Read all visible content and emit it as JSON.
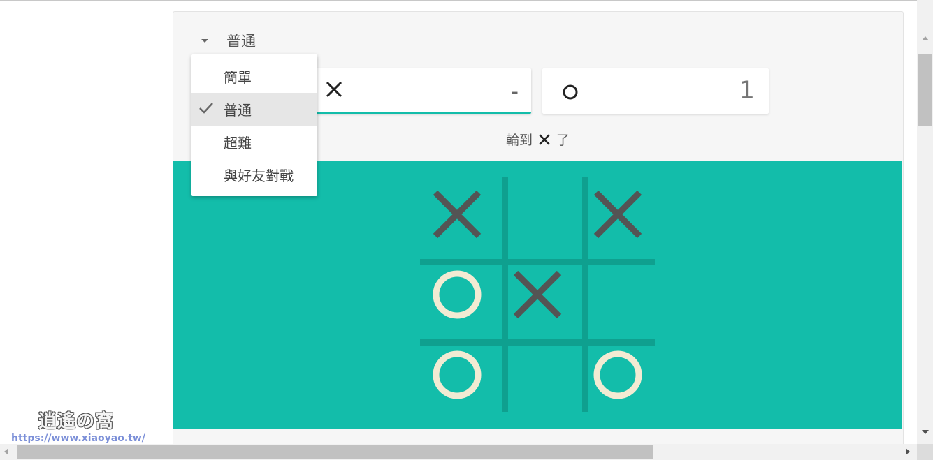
{
  "level_select": {
    "current": "普通",
    "icon": "caret-down-icon"
  },
  "dropdown": {
    "items": [
      {
        "label": "簡單",
        "selected": false
      },
      {
        "label": "普通",
        "selected": true
      },
      {
        "label": "超難",
        "selected": false
      },
      {
        "label": "與好友對戰",
        "selected": false
      }
    ],
    "check_icon": "check-icon"
  },
  "score": {
    "x": {
      "mark": "X",
      "value": "-",
      "active": true
    },
    "o": {
      "mark": "O",
      "value": "1",
      "active": false
    }
  },
  "turn": {
    "prefix": "輪到",
    "mark": "X",
    "suffix": "了"
  },
  "board": {
    "cells": [
      [
        "X",
        "",
        "X"
      ],
      [
        "O",
        "X",
        ""
      ],
      [
        "O",
        "",
        "O"
      ]
    ]
  },
  "colors": {
    "board_bg": "#13bdaa",
    "grid_line": "#0fa08f",
    "x_mark": "#545454",
    "o_mark": "#f2ebd3",
    "active_underline": "#13bdaa"
  },
  "watermark": {
    "logo_text": "逍遙の窩",
    "url": "https://www.xiaoyao.tw/"
  }
}
